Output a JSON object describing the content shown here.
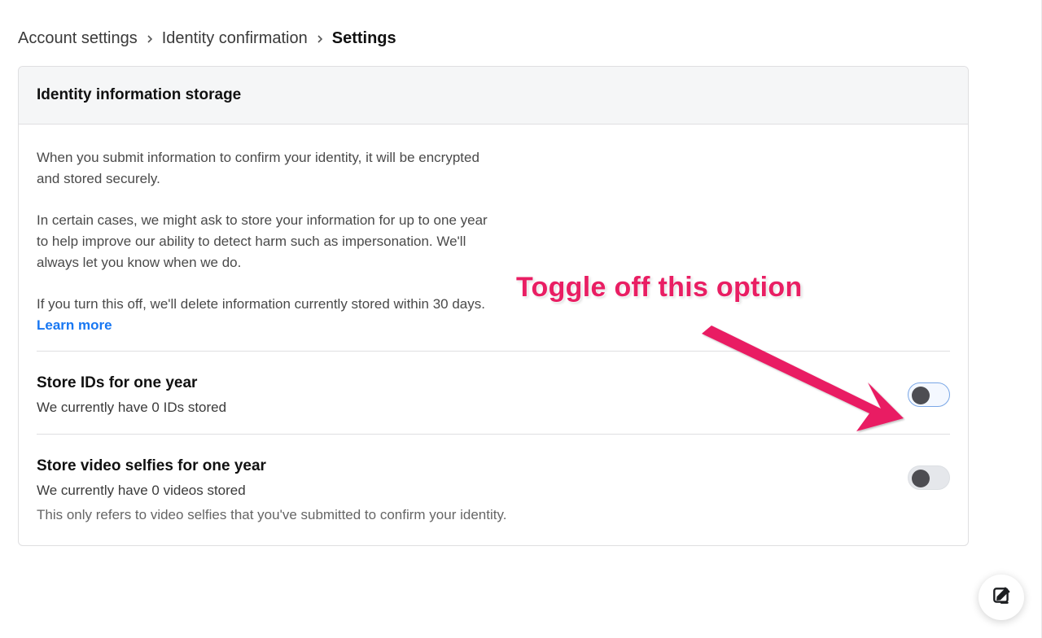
{
  "breadcrumb": {
    "items": [
      {
        "label": "Account settings"
      },
      {
        "label": "Identity confirmation"
      },
      {
        "label": "Settings"
      }
    ]
  },
  "card": {
    "title": "Identity information storage",
    "paragraphs": [
      "When you submit information to confirm your identity, it will be encrypted and stored securely.",
      "In certain cases, we might ask to store your information for up to one year to help improve our ability to detect harm such as impersonation. We'll always let you know when we do.",
      "If you turn this off, we'll delete information currently stored within 30 days."
    ],
    "learn_more": "Learn more"
  },
  "settings": [
    {
      "title": "Store IDs for one year",
      "subtitle": "We currently have 0 IDs stored",
      "help": "",
      "state": "off",
      "highlighted": true
    },
    {
      "title": "Store video selfies for one year",
      "subtitle": "We currently have 0 videos stored",
      "help": "This only refers to video selfies that you've submitted to confirm your identity.",
      "state": "off",
      "highlighted": false
    }
  ],
  "annotation": {
    "label": "Toggle off this option"
  },
  "colors": {
    "accent_pink": "#e91e63",
    "link_blue": "#1877f2"
  }
}
